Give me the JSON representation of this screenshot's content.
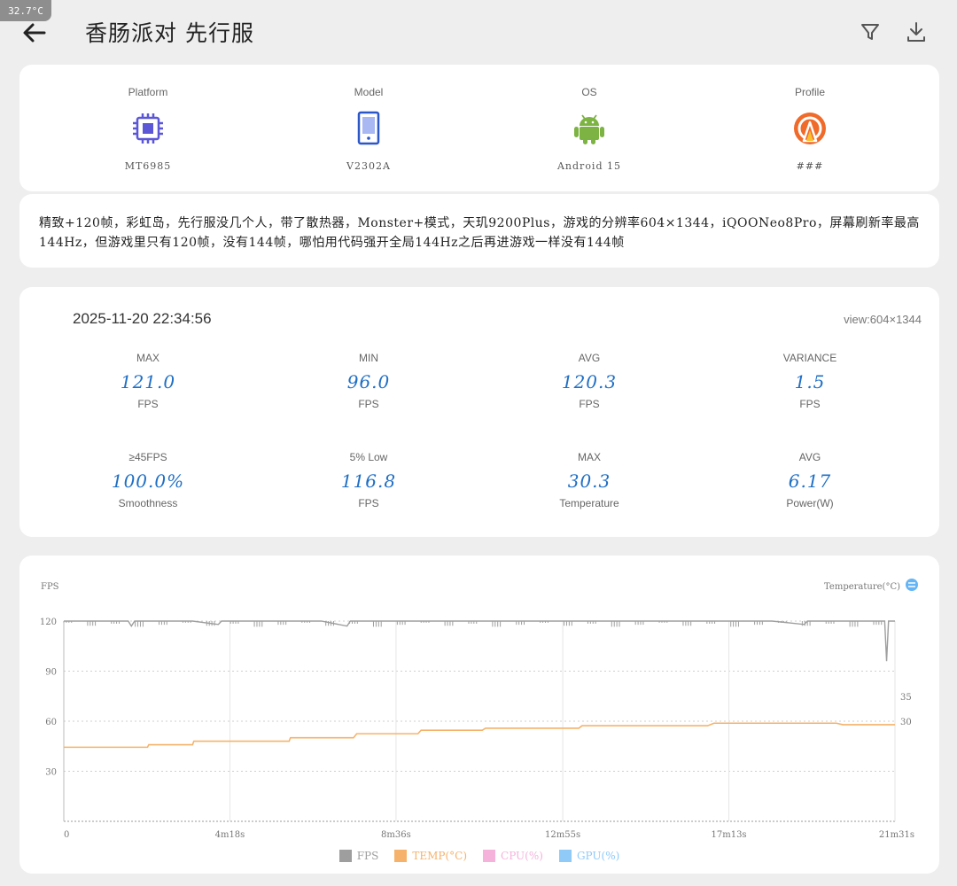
{
  "status": {
    "temperature": "32.7°C"
  },
  "header": {
    "title": "香肠派对 先行服"
  },
  "device": [
    {
      "label": "Platform",
      "value": "MT6985",
      "icon": "chip-icon"
    },
    {
      "label": "Model",
      "value": "V2302A",
      "icon": "phone-icon"
    },
    {
      "label": "OS",
      "value": "Android 15",
      "icon": "android-icon"
    },
    {
      "label": "Profile",
      "value": "###",
      "icon": "profile-icon"
    }
  ],
  "note": "精致+120帧，彩虹岛，先行服没几个人，带了散热器，Monster+模式，天玑9200Plus，游戏的分辨率604×1344，iQOONeo8Pro，屏幕刷新率最高144Hz，但游戏里只有120帧，没有144帧，哪怕用代码强开全局144Hz之后再进游戏一样没有144帧",
  "stats": {
    "date": "2025-11-20 22:34:56",
    "view": "view:604×1344",
    "items": [
      {
        "label": "MAX",
        "value": "121.0",
        "unit": "FPS"
      },
      {
        "label": "MIN",
        "value": "96.0",
        "unit": "FPS"
      },
      {
        "label": "AVG",
        "value": "120.3",
        "unit": "FPS"
      },
      {
        "label": "VARIANCE",
        "value": "1.5",
        "unit": "FPS"
      },
      {
        "label": "≥45FPS",
        "value": "100.0%",
        "unit": "Smoothness"
      },
      {
        "label": "5% Low",
        "value": "116.8",
        "unit": "FPS"
      },
      {
        "label": "MAX",
        "value": "30.3",
        "unit": "Temperature"
      },
      {
        "label": "AVG",
        "value": "6.17",
        "unit": "Power(W)"
      }
    ]
  },
  "chart_data": {
    "type": "line",
    "ylabel_left": "FPS",
    "ylabel_right": "Temperature(°C)",
    "left_ticks": [
      120,
      90,
      60,
      30
    ],
    "left_ylim": [
      0,
      120
    ],
    "right_ticks": [
      35,
      30
    ],
    "x_ticks": [
      "0",
      "4m18s",
      "8m36s",
      "12m55s",
      "17m13s",
      "21m31s"
    ],
    "x_seconds": [
      0,
      258,
      516,
      775,
      1033,
      1291
    ],
    "grid": true,
    "legend_position": "bottom",
    "series": [
      {
        "name": "FPS",
        "color": "#9e9e9e",
        "points": [
          [
            0,
            120
          ],
          [
            100,
            120
          ],
          [
            105,
            117
          ],
          [
            110,
            120
          ],
          [
            200,
            120
          ],
          [
            240,
            118
          ],
          [
            245,
            120
          ],
          [
            300,
            120
          ],
          [
            400,
            120
          ],
          [
            440,
            117
          ],
          [
            445,
            120
          ],
          [
            600,
            120
          ],
          [
            700,
            120
          ],
          [
            900,
            120
          ],
          [
            1000,
            120
          ],
          [
            1100,
            120
          ],
          [
            1150,
            118
          ],
          [
            1155,
            120
          ],
          [
            1275,
            120
          ],
          [
            1278,
            96
          ],
          [
            1281,
            120
          ],
          [
            1291,
            120
          ]
        ]
      },
      {
        "name": "TEMP(°C)",
        "color": "#f6b26b",
        "points": [
          [
            0,
            24.8
          ],
          [
            130,
            24.8
          ],
          [
            132,
            25.3
          ],
          [
            200,
            25.3
          ],
          [
            202,
            26.0
          ],
          [
            350,
            26.0
          ],
          [
            352,
            26.7
          ],
          [
            450,
            26.7
          ],
          [
            455,
            27.5
          ],
          [
            550,
            27.5
          ],
          [
            555,
            28.2
          ],
          [
            650,
            28.2
          ],
          [
            655,
            28.6
          ],
          [
            800,
            28.6
          ],
          [
            805,
            29.1
          ],
          [
            1000,
            29.1
          ],
          [
            1010,
            29.6
          ],
          [
            1200,
            29.6
          ],
          [
            1210,
            29.3
          ],
          [
            1291,
            29.3
          ]
        ]
      },
      {
        "name": "CPU(%)",
        "color": "#f5b3dc",
        "points": []
      },
      {
        "name": "GPU(%)",
        "color": "#90caf9",
        "points": []
      }
    ]
  }
}
